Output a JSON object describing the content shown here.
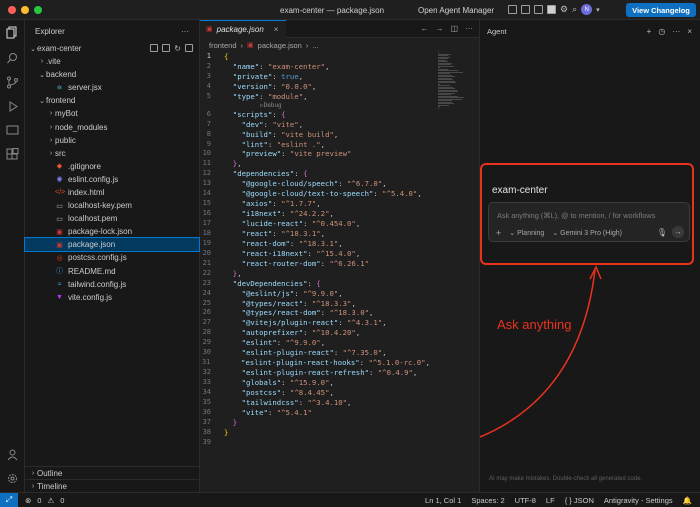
{
  "titlebar": {
    "title": "exam-center — package.json",
    "agent_manager": "Open Agent Manager",
    "changelog_button": "View Changelog",
    "avatar_initials": "N"
  },
  "sidebar": {
    "header": "Explorer",
    "project": "exam-center",
    "tree": [
      {
        "label": ".vite",
        "type": "folder",
        "depth": 1,
        "open": false
      },
      {
        "label": "backend",
        "type": "folder",
        "depth": 1,
        "open": true
      },
      {
        "label": "server.jsx",
        "type": "jsx",
        "depth": 2
      },
      {
        "label": "frontend",
        "type": "folder",
        "depth": 1,
        "open": true
      },
      {
        "label": "myBot",
        "type": "folder",
        "depth": 2,
        "open": false
      },
      {
        "label": "node_modules",
        "type": "folder",
        "depth": 2,
        "open": false
      },
      {
        "label": "public",
        "type": "folder",
        "depth": 2,
        "open": false
      },
      {
        "label": "src",
        "type": "folder",
        "depth": 2,
        "open": false
      },
      {
        "label": ".gitignore",
        "type": "git",
        "depth": 2
      },
      {
        "label": "eslint.config.js",
        "type": "eslint",
        "depth": 2
      },
      {
        "label": "index.html",
        "type": "html",
        "depth": 2
      },
      {
        "label": "localhost-key.pem",
        "type": "pem",
        "depth": 2
      },
      {
        "label": "localhost.pem",
        "type": "pem",
        "depth": 2
      },
      {
        "label": "package-lock.json",
        "type": "npm",
        "depth": 2
      },
      {
        "label": "package.json",
        "type": "npm",
        "depth": 2,
        "selected": true
      },
      {
        "label": "postcss.config.js",
        "type": "postcss",
        "depth": 2
      },
      {
        "label": "README.md",
        "type": "md",
        "depth": 2
      },
      {
        "label": "tailwind.config.js",
        "type": "tailwind",
        "depth": 2
      },
      {
        "label": "vite.config.js",
        "type": "vite",
        "depth": 2
      }
    ],
    "outline": "Outline",
    "timeline": "Timeline"
  },
  "editor": {
    "tab_label": "package.json",
    "breadcrumb": [
      "frontend",
      "package.json",
      "..."
    ],
    "codelens": "▷Debug",
    "lines": [
      [
        {
          "t": "{",
          "c": "p1"
        }
      ],
      [
        {
          "t": "  "
        },
        {
          "t": "\"name\"",
          "c": "k"
        },
        {
          "t": ": "
        },
        {
          "t": "\"exam-center\"",
          "c": "s"
        },
        {
          "t": ","
        }
      ],
      [
        {
          "t": "  "
        },
        {
          "t": "\"private\"",
          "c": "k"
        },
        {
          "t": ": "
        },
        {
          "t": "true",
          "c": "b"
        },
        {
          "t": ","
        }
      ],
      [
        {
          "t": "  "
        },
        {
          "t": "\"version\"",
          "c": "k"
        },
        {
          "t": ": "
        },
        {
          "t": "\"0.0.0\"",
          "c": "s"
        },
        {
          "t": ","
        }
      ],
      [
        {
          "t": "  "
        },
        {
          "t": "\"type\"",
          "c": "k"
        },
        {
          "t": ": "
        },
        {
          "t": "\"module\"",
          "c": "s"
        },
        {
          "t": ","
        }
      ],
      [
        {
          "t": "  "
        },
        {
          "t": "\"scripts\"",
          "c": "k"
        },
        {
          "t": ": "
        },
        {
          "t": "{",
          "c": "p2"
        }
      ],
      [
        {
          "t": "    "
        },
        {
          "t": "\"dev\"",
          "c": "k"
        },
        {
          "t": ": "
        },
        {
          "t": "\"vite\"",
          "c": "s"
        },
        {
          "t": ","
        }
      ],
      [
        {
          "t": "    "
        },
        {
          "t": "\"build\"",
          "c": "k"
        },
        {
          "t": ": "
        },
        {
          "t": "\"vite build\"",
          "c": "s"
        },
        {
          "t": ","
        }
      ],
      [
        {
          "t": "    "
        },
        {
          "t": "\"lint\"",
          "c": "k"
        },
        {
          "t": ": "
        },
        {
          "t": "\"eslint .\"",
          "c": "s"
        },
        {
          "t": ","
        }
      ],
      [
        {
          "t": "    "
        },
        {
          "t": "\"preview\"",
          "c": "k"
        },
        {
          "t": ": "
        },
        {
          "t": "\"vite preview\"",
          "c": "s"
        }
      ],
      [
        {
          "t": "  "
        },
        {
          "t": "}",
          "c": "p2"
        },
        {
          "t": ","
        }
      ],
      [
        {
          "t": "  "
        },
        {
          "t": "\"dependencies\"",
          "c": "k"
        },
        {
          "t": ": "
        },
        {
          "t": "{",
          "c": "p2"
        }
      ],
      [
        {
          "t": "    "
        },
        {
          "t": "\"@google-cloud/speech\"",
          "c": "k"
        },
        {
          "t": ": "
        },
        {
          "t": "\"^6.7.0\"",
          "c": "s"
        },
        {
          "t": ","
        }
      ],
      [
        {
          "t": "    "
        },
        {
          "t": "\"@google-cloud/text-to-speech\"",
          "c": "k"
        },
        {
          "t": ": "
        },
        {
          "t": "\"^5.4.0\"",
          "c": "s"
        },
        {
          "t": ","
        }
      ],
      [
        {
          "t": "    "
        },
        {
          "t": "\"axios\"",
          "c": "k"
        },
        {
          "t": ": "
        },
        {
          "t": "\"^1.7.7\"",
          "c": "s"
        },
        {
          "t": ","
        }
      ],
      [
        {
          "t": "    "
        },
        {
          "t": "\"i18next\"",
          "c": "k"
        },
        {
          "t": ": "
        },
        {
          "t": "\"^24.2.2\"",
          "c": "s"
        },
        {
          "t": ","
        }
      ],
      [
        {
          "t": "    "
        },
        {
          "t": "\"lucide-react\"",
          "c": "k"
        },
        {
          "t": ": "
        },
        {
          "t": "\"^0.454.0\"",
          "c": "s"
        },
        {
          "t": ","
        }
      ],
      [
        {
          "t": "    "
        },
        {
          "t": "\"react\"",
          "c": "k"
        },
        {
          "t": ": "
        },
        {
          "t": "\"^18.3.1\"",
          "c": "s"
        },
        {
          "t": ","
        }
      ],
      [
        {
          "t": "    "
        },
        {
          "t": "\"react-dom\"",
          "c": "k"
        },
        {
          "t": ": "
        },
        {
          "t": "\"^18.3.1\"",
          "c": "s"
        },
        {
          "t": ","
        }
      ],
      [
        {
          "t": "    "
        },
        {
          "t": "\"react-i18next\"",
          "c": "k"
        },
        {
          "t": ": "
        },
        {
          "t": "\"^15.4.0\"",
          "c": "s"
        },
        {
          "t": ","
        }
      ],
      [
        {
          "t": "    "
        },
        {
          "t": "\"react-router-dom\"",
          "c": "k"
        },
        {
          "t": ": "
        },
        {
          "t": "\"^6.26.1\"",
          "c": "s"
        }
      ],
      [
        {
          "t": "  "
        },
        {
          "t": "}",
          "c": "p2"
        },
        {
          "t": ","
        }
      ],
      [
        {
          "t": "  "
        },
        {
          "t": "\"devDependencies\"",
          "c": "k"
        },
        {
          "t": ": "
        },
        {
          "t": "{",
          "c": "p2"
        }
      ],
      [
        {
          "t": "    "
        },
        {
          "t": "\"@eslint/js\"",
          "c": "k"
        },
        {
          "t": ": "
        },
        {
          "t": "\"^9.9.0\"",
          "c": "s"
        },
        {
          "t": ","
        }
      ],
      [
        {
          "t": "    "
        },
        {
          "t": "\"@types/react\"",
          "c": "k"
        },
        {
          "t": ": "
        },
        {
          "t": "\"^18.3.3\"",
          "c": "s"
        },
        {
          "t": ","
        }
      ],
      [
        {
          "t": "    "
        },
        {
          "t": "\"@types/react-dom\"",
          "c": "k"
        },
        {
          "t": ": "
        },
        {
          "t": "\"^18.3.0\"",
          "c": "s"
        },
        {
          "t": ","
        }
      ],
      [
        {
          "t": "    "
        },
        {
          "t": "\"@vitejs/plugin-react\"",
          "c": "k"
        },
        {
          "t": ": "
        },
        {
          "t": "\"^4.3.1\"",
          "c": "s"
        },
        {
          "t": ","
        }
      ],
      [
        {
          "t": "    "
        },
        {
          "t": "\"autoprefixer\"",
          "c": "k"
        },
        {
          "t": ": "
        },
        {
          "t": "\"^10.4.20\"",
          "c": "s"
        },
        {
          "t": ","
        }
      ],
      [
        {
          "t": "    "
        },
        {
          "t": "\"eslint\"",
          "c": "k"
        },
        {
          "t": ": "
        },
        {
          "t": "\"^9.9.0\"",
          "c": "s"
        },
        {
          "t": ","
        }
      ],
      [
        {
          "t": "    "
        },
        {
          "t": "\"eslint-plugin-react\"",
          "c": "k"
        },
        {
          "t": ": "
        },
        {
          "t": "\"^7.35.0\"",
          "c": "s"
        },
        {
          "t": ","
        }
      ],
      [
        {
          "t": "    "
        },
        {
          "t": "\"eslint-plugin-react-hooks\"",
          "c": "k"
        },
        {
          "t": ": "
        },
        {
          "t": "\"^5.1.0-rc.0\"",
          "c": "s"
        },
        {
          "t": ","
        }
      ],
      [
        {
          "t": "    "
        },
        {
          "t": "\"eslint-plugin-react-refresh\"",
          "c": "k"
        },
        {
          "t": ": "
        },
        {
          "t": "\"^0.4.9\"",
          "c": "s"
        },
        {
          "t": ","
        }
      ],
      [
        {
          "t": "    "
        },
        {
          "t": "\"globals\"",
          "c": "k"
        },
        {
          "t": ": "
        },
        {
          "t": "\"^15.9.0\"",
          "c": "s"
        },
        {
          "t": ","
        }
      ],
      [
        {
          "t": "    "
        },
        {
          "t": "\"postcss\"",
          "c": "k"
        },
        {
          "t": ": "
        },
        {
          "t": "\"^8.4.45\"",
          "c": "s"
        },
        {
          "t": ","
        }
      ],
      [
        {
          "t": "    "
        },
        {
          "t": "\"tailwindcss\"",
          "c": "k"
        },
        {
          "t": ": "
        },
        {
          "t": "\"^3.4.10\"",
          "c": "s"
        },
        {
          "t": ","
        }
      ],
      [
        {
          "t": "    "
        },
        {
          "t": "\"vite\"",
          "c": "k"
        },
        {
          "t": ": "
        },
        {
          "t": "\"^5.4.1\"",
          "c": "s"
        }
      ],
      [
        {
          "t": "  "
        },
        {
          "t": "}",
          "c": "p2"
        }
      ],
      [
        {
          "t": "}",
          "c": "p1"
        }
      ],
      []
    ]
  },
  "agent": {
    "header": "Agent",
    "project_title": "exam-center",
    "input_placeholder": "Ask anything (⌘L), @ to mention, / for workflows",
    "mode": "Planning",
    "model": "Gemini 3 Pro (High)",
    "annotation": "Ask anything",
    "disclaimer": "AI may make mistakes. Double-check all generated code."
  },
  "statusbar": {
    "errors": "0",
    "warnings": "0",
    "position": "Ln 1, Col 1",
    "spaces": "Spaces: 2",
    "encoding": "UTF-8",
    "eol": "LF",
    "language": "{ } JSON",
    "settings": "Antigravity - Settings"
  },
  "colors": {
    "accent": "#0e70c0",
    "annotation": "#e8321e",
    "selection": "#04395e"
  }
}
